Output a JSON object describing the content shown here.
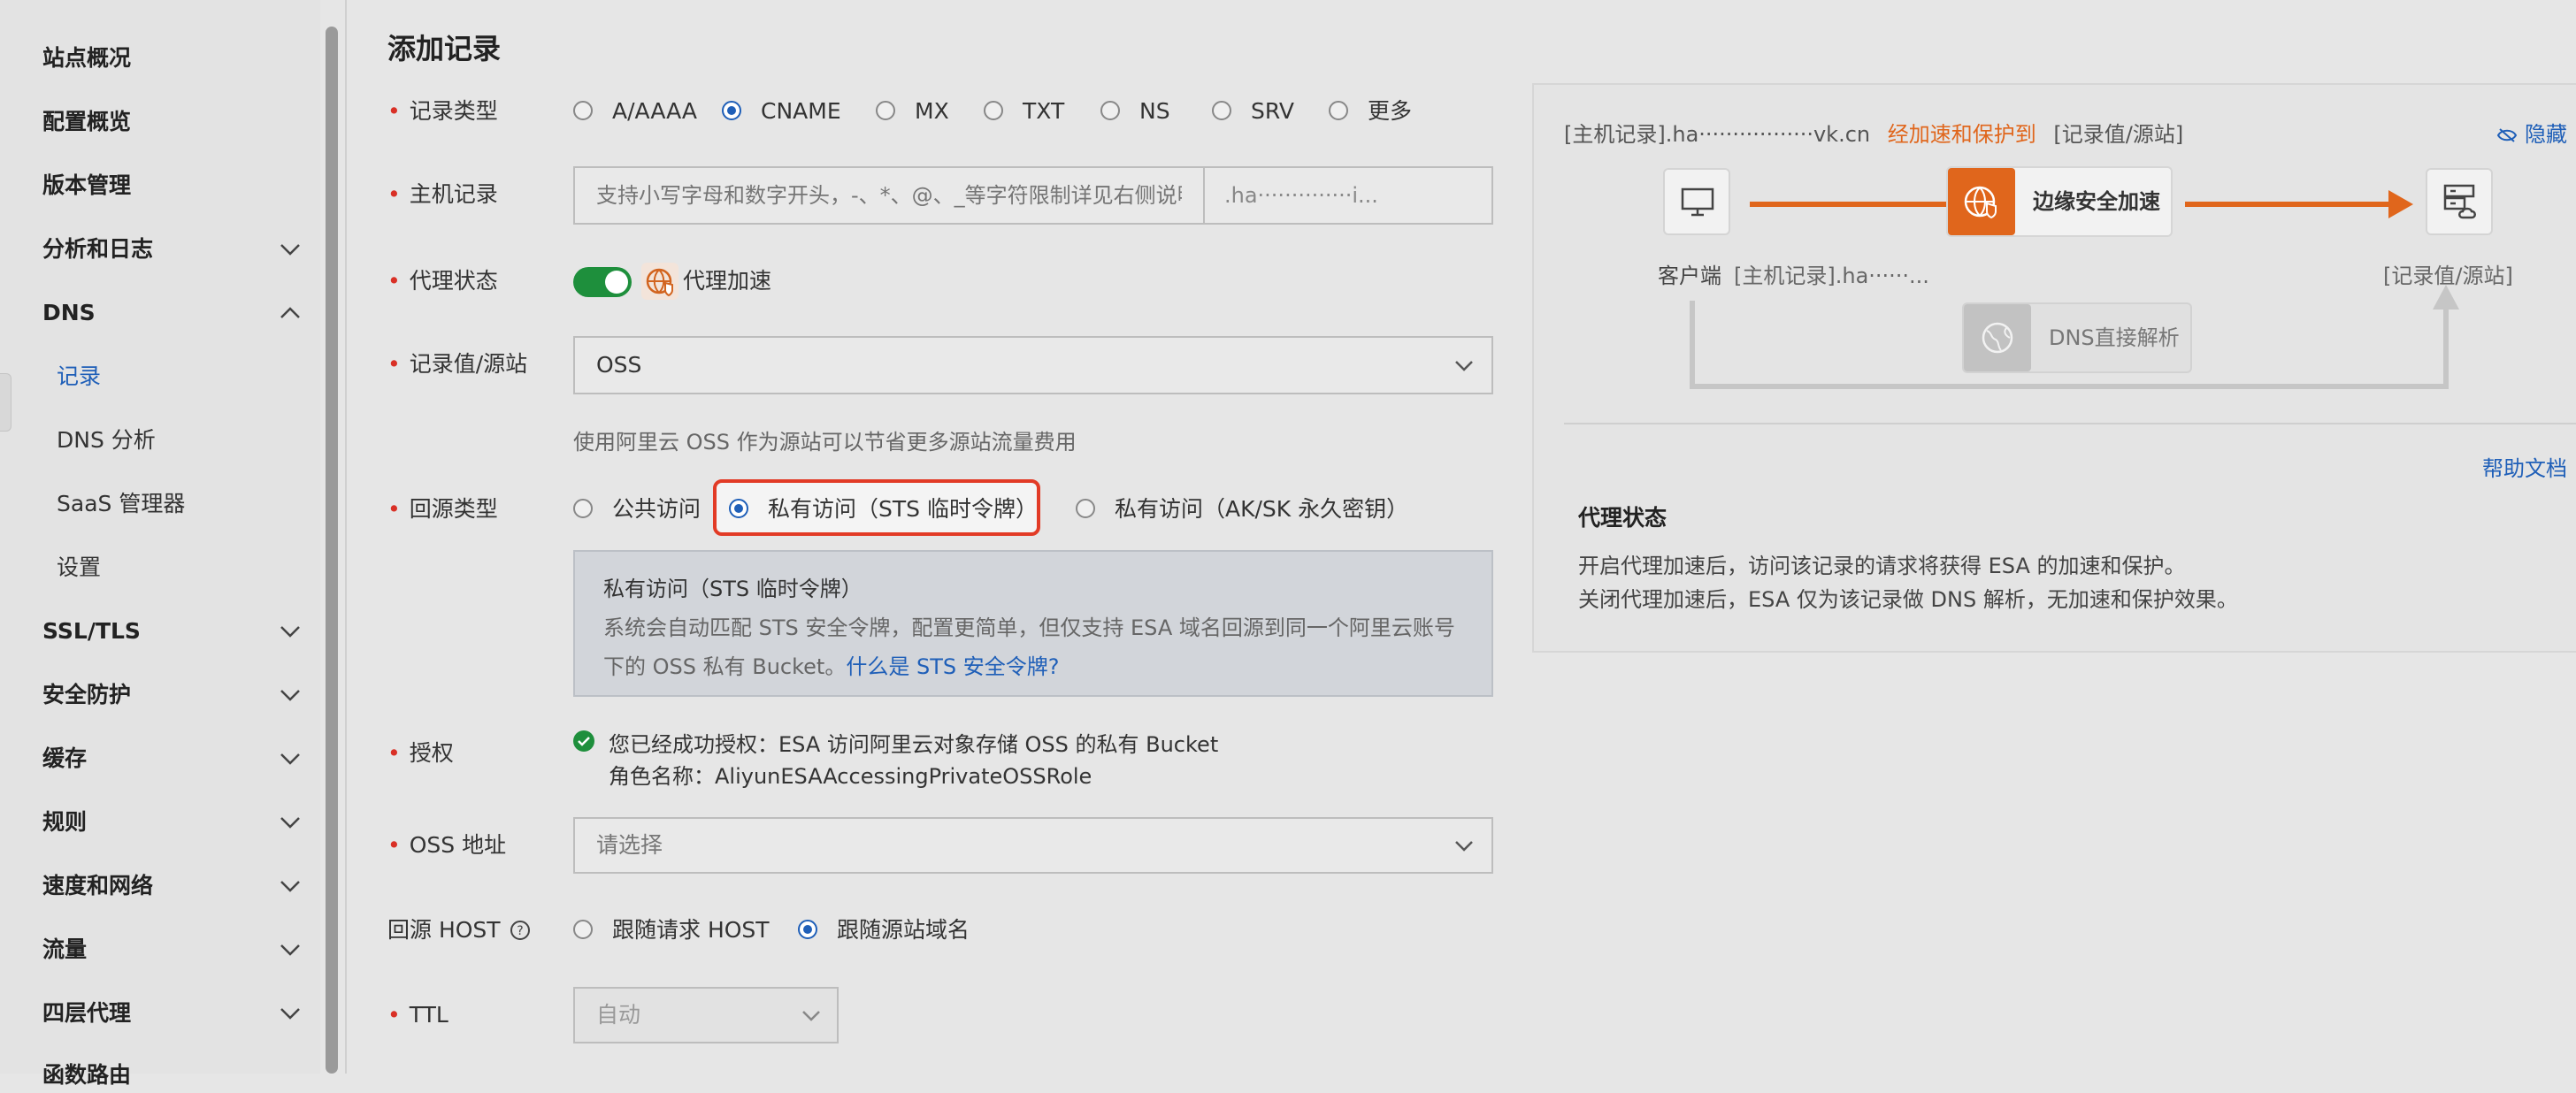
{
  "sidebar": {
    "items": [
      {
        "label": "站点概况",
        "expandable": false
      },
      {
        "label": "配置概览",
        "expandable": false
      },
      {
        "label": "版本管理",
        "expandable": false
      },
      {
        "label": "分析和日志",
        "expandable": true
      },
      {
        "label": "DNS",
        "expandable": true,
        "expanded": true
      },
      {
        "label": "SSL/TLS",
        "expandable": true
      },
      {
        "label": "安全防护",
        "expandable": true
      },
      {
        "label": "缓存",
        "expandable": true
      },
      {
        "label": "规则",
        "expandable": true
      },
      {
        "label": "速度和网络",
        "expandable": true
      },
      {
        "label": "流量",
        "expandable": true
      },
      {
        "label": "四层代理",
        "expandable": true
      },
      {
        "label": "函数路由",
        "expandable": false
      }
    ],
    "dns_children": [
      "记录",
      "DNS 分析",
      "SaaS 管理器",
      "设置"
    ],
    "active_child": "记录"
  },
  "form": {
    "title": "添加记录",
    "record_type": {
      "label": "记录类型",
      "options": [
        "A/AAAA",
        "CNAME",
        "MX",
        "TXT",
        "NS",
        "SRV",
        "更多"
      ],
      "selected": "CNAME"
    },
    "host": {
      "label": "主机记录",
      "placeholder": "支持小写字母和数字开头，-、*、@、_等字符限制详见右侧说明",
      "suffix": ".ha··············i..."
    },
    "proxy": {
      "label": "代理状态",
      "text": "代理加速",
      "on": true
    },
    "origin": {
      "label": "记录值/源站",
      "value": "OSS",
      "hint": "使用阿里云 OSS 作为源站可以节省更多源站流量费用"
    },
    "origin_type": {
      "label": "回源类型",
      "options": [
        "公共访问",
        "私有访问（STS 临时令牌）",
        "私有访问（AK/SK 永久密钥）"
      ],
      "selected": "私有访问（STS 临时令牌）"
    },
    "sts_info": {
      "title": "私有访问（STS 临时令牌）",
      "desc1": "系统会自动匹配 STS 安全令牌，配置更简单，但仅支持 ESA 域名回源到同一个阿里云账号",
      "desc2": "下的 OSS 私有 Bucket。",
      "link": "什么是 STS 安全令牌?"
    },
    "auth": {
      "label": "授权",
      "line1": "您已经成功授权：ESA 访问阿里云对象存储 OSS 的私有 Bucket",
      "line2": "角色名称：AliyunESAAccessingPrivateOSSRole"
    },
    "oss_addr": {
      "label": "OSS 地址",
      "placeholder": "请选择"
    },
    "origin_host": {
      "label": "回源 HOST",
      "options": [
        "跟随请求 HOST",
        "跟随源站域名"
      ],
      "selected": "跟随源站域名"
    },
    "ttl": {
      "label": "TTL",
      "value": "自动"
    }
  },
  "panel": {
    "head_record": "[主机记录].ha·················vk.cn",
    "head_mid": "经加速和保护到",
    "head_target": "[记录值/源站]",
    "hide": "隐藏",
    "client": "客户端",
    "host_small": "[主机记录].ha······...",
    "edge": "边缘安全加速",
    "target": "[记录值/源站]",
    "dns_direct": "DNS直接解析",
    "help": "帮助文档",
    "status_title": "代理状态",
    "status_line1": "开启代理加速后，访问该记录的请求将获得 ESA 的加速和保护。",
    "status_line2": "关闭代理加速后，ESA 仅为该记录做 DNS 解析，无加速和保护效果。"
  },
  "colors": {
    "accent": "#1f5fb8",
    "orange": "#e0661c",
    "green": "#1e8f3c",
    "red": "#e23b26"
  }
}
